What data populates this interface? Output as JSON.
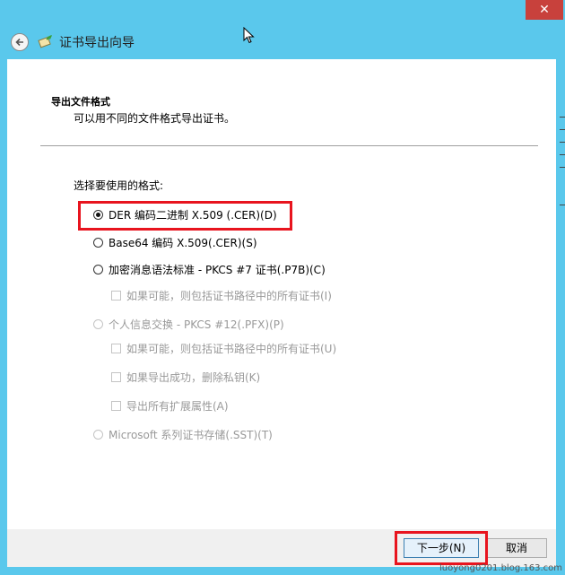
{
  "window": {
    "title": "证书导出向导",
    "close_label": "✕"
  },
  "page": {
    "heading": "导出文件格式",
    "subheading": "可以用不同的文件格式导出证书。",
    "prompt": "选择要使用的格式:"
  },
  "options": [
    {
      "label": "DER 编码二进制 X.509 (.CER)(D)",
      "type": "radio",
      "checked": true,
      "enabled": true
    },
    {
      "label": "Base64 编码 X.509(.CER)(S)",
      "type": "radio",
      "checked": false,
      "enabled": true
    },
    {
      "label": "加密消息语法标准 - PKCS #7 证书(.P7B)(C)",
      "type": "radio",
      "checked": false,
      "enabled": true
    },
    {
      "label": "如果可能，则包括证书路径中的所有证书(I)",
      "type": "checkbox",
      "checked": false,
      "enabled": false
    },
    {
      "label": "个人信息交换 - PKCS #12(.PFX)(P)",
      "type": "radio",
      "checked": false,
      "enabled": false
    },
    {
      "label": "如果可能，则包括证书路径中的所有证书(U)",
      "type": "checkbox",
      "checked": false,
      "enabled": false
    },
    {
      "label": "如果导出成功，删除私钥(K)",
      "type": "checkbox",
      "checked": false,
      "enabled": false
    },
    {
      "label": "导出所有扩展属性(A)",
      "type": "checkbox",
      "checked": false,
      "enabled": false
    },
    {
      "label": "Microsoft 系列证书存储(.SST)(T)",
      "type": "radio",
      "checked": false,
      "enabled": false
    }
  ],
  "buttons": {
    "next_label": "下一步(N)",
    "cancel_label": "取消"
  },
  "watermark": "luoyong0201.blog.163.com",
  "colors": {
    "titlebar": "#5ac8ec",
    "close": "#c8413c",
    "highlight": "#e8141e"
  }
}
